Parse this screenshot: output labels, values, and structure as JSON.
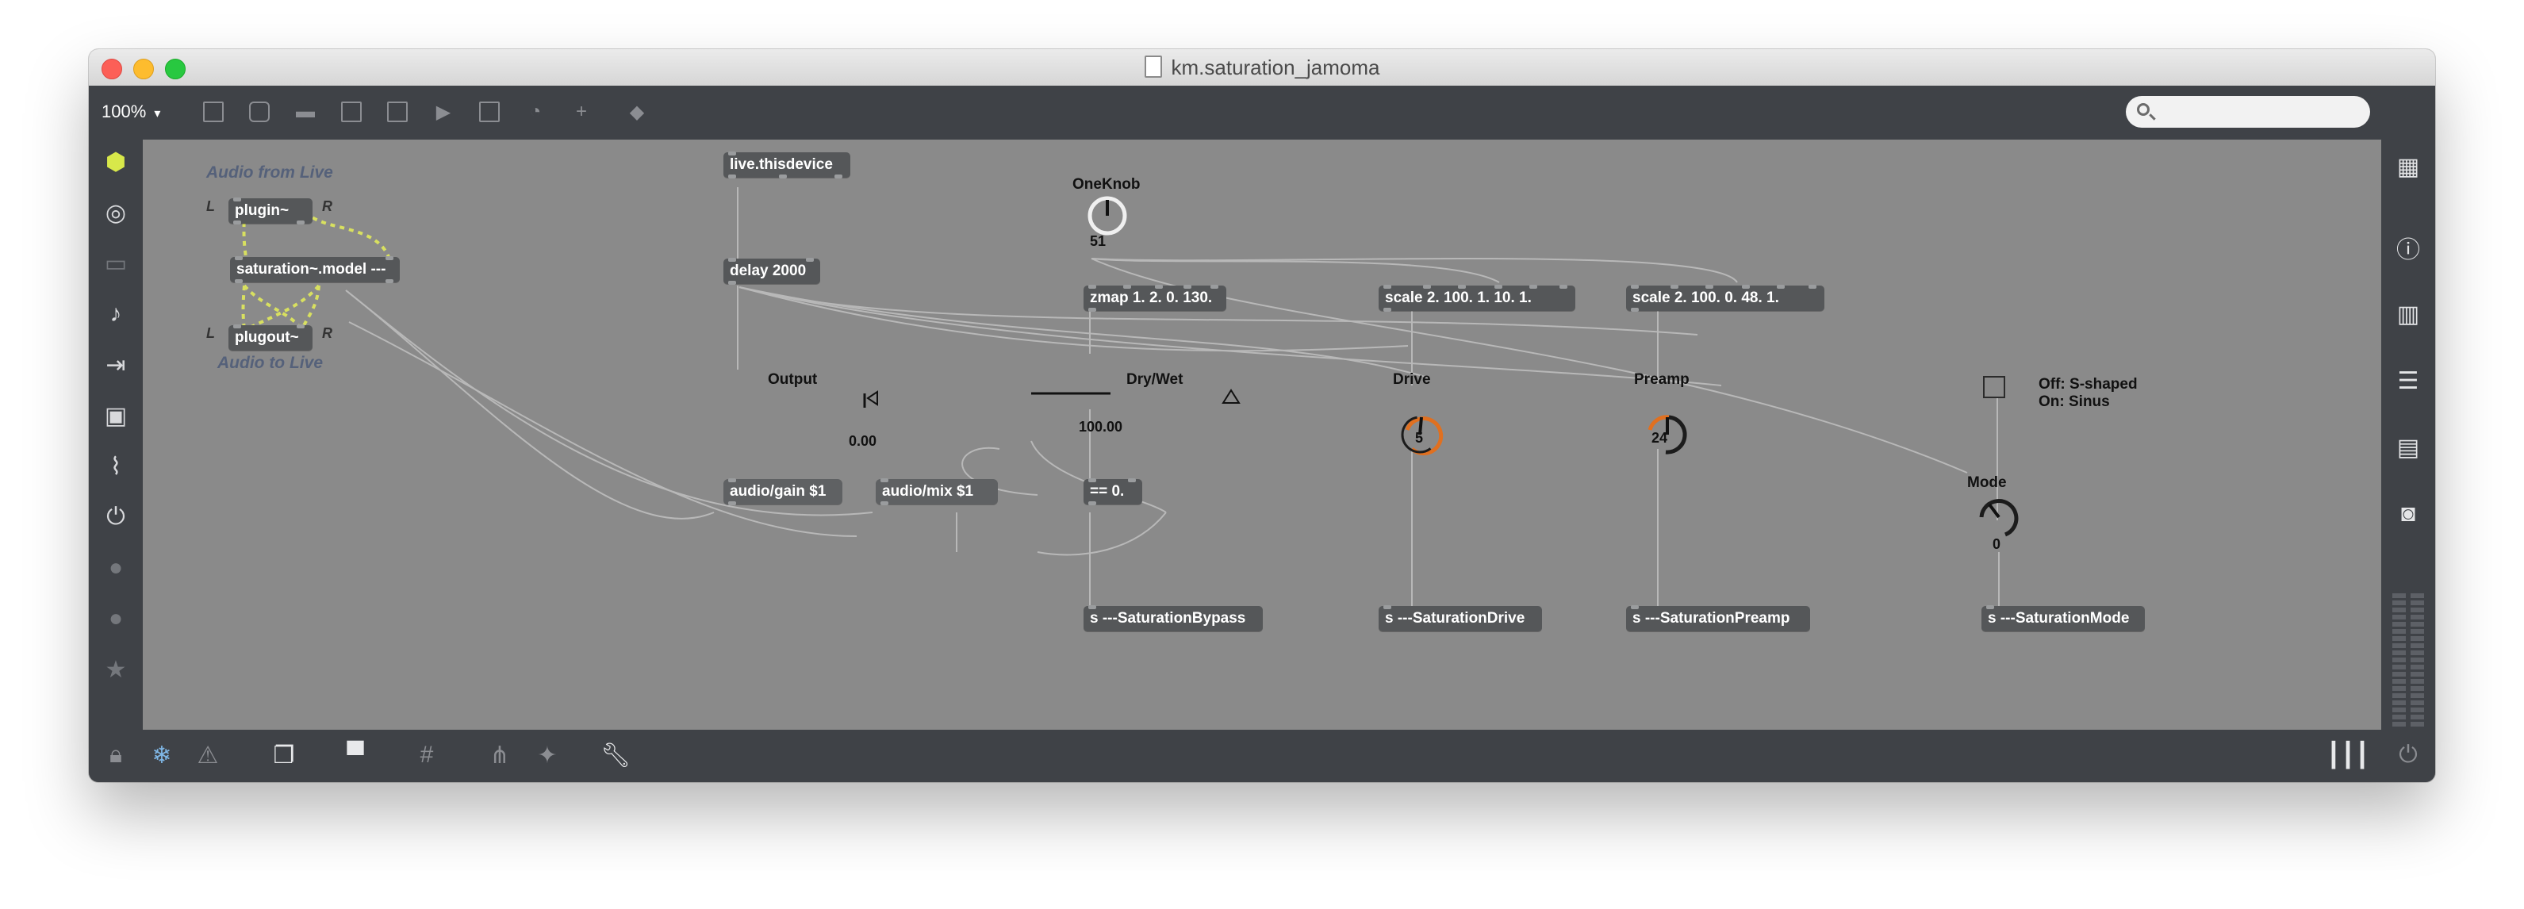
{
  "window": {
    "title": "km.saturation_jamoma"
  },
  "toolbar": {
    "zoom": "100%",
    "zoom_arrow": "▾",
    "search_placeholder": ""
  },
  "patch": {
    "comments": {
      "audio_from_live": "Audio from Live",
      "audio_to_live": "Audio to Live",
      "l_top": "L",
      "r_top": "R",
      "l_bottom": "L",
      "r_bottom": "R",
      "output": "Output",
      "dry_wet": "Dry/Wet",
      "one_knob": "OneKnob",
      "drive": "Drive",
      "preamp": "Preamp",
      "mode": "Mode",
      "off_shaped": "Off: S-shaped",
      "on_sinus": "On: Sinus"
    },
    "objects": {
      "plugin": "plugin~",
      "saturation_model": "saturation~.model ---",
      "plugout": "plugout~",
      "live_thisdevice": "live.thisdevice",
      "delay": "delay 2000",
      "audio_gain": "audio/gain $1",
      "audio_mix": "audio/mix $1",
      "zmap": "zmap 1. 2. 0. 130.",
      "scale_drive": "scale 2. 100. 1. 10. 1.",
      "scale_preamp": "scale 2. 100. 0. 48. 1.",
      "eq_zero": "== 0.",
      "send_bypass": "s ---SaturationBypass",
      "send_drive": "s ---SaturationDrive",
      "send_preamp": "s ---SaturationPreamp",
      "send_mode": "s ---SaturationMode"
    },
    "values": {
      "output_gain": "0.00",
      "dry_wet": "100.00",
      "one_knob": "51",
      "drive": "5",
      "preamp": "24",
      "mode": "0"
    }
  },
  "colors": {
    "canvas": "#8a8a8a",
    "object": "#555759",
    "chrome": "#3f4247",
    "dial_active": "#e07020"
  }
}
